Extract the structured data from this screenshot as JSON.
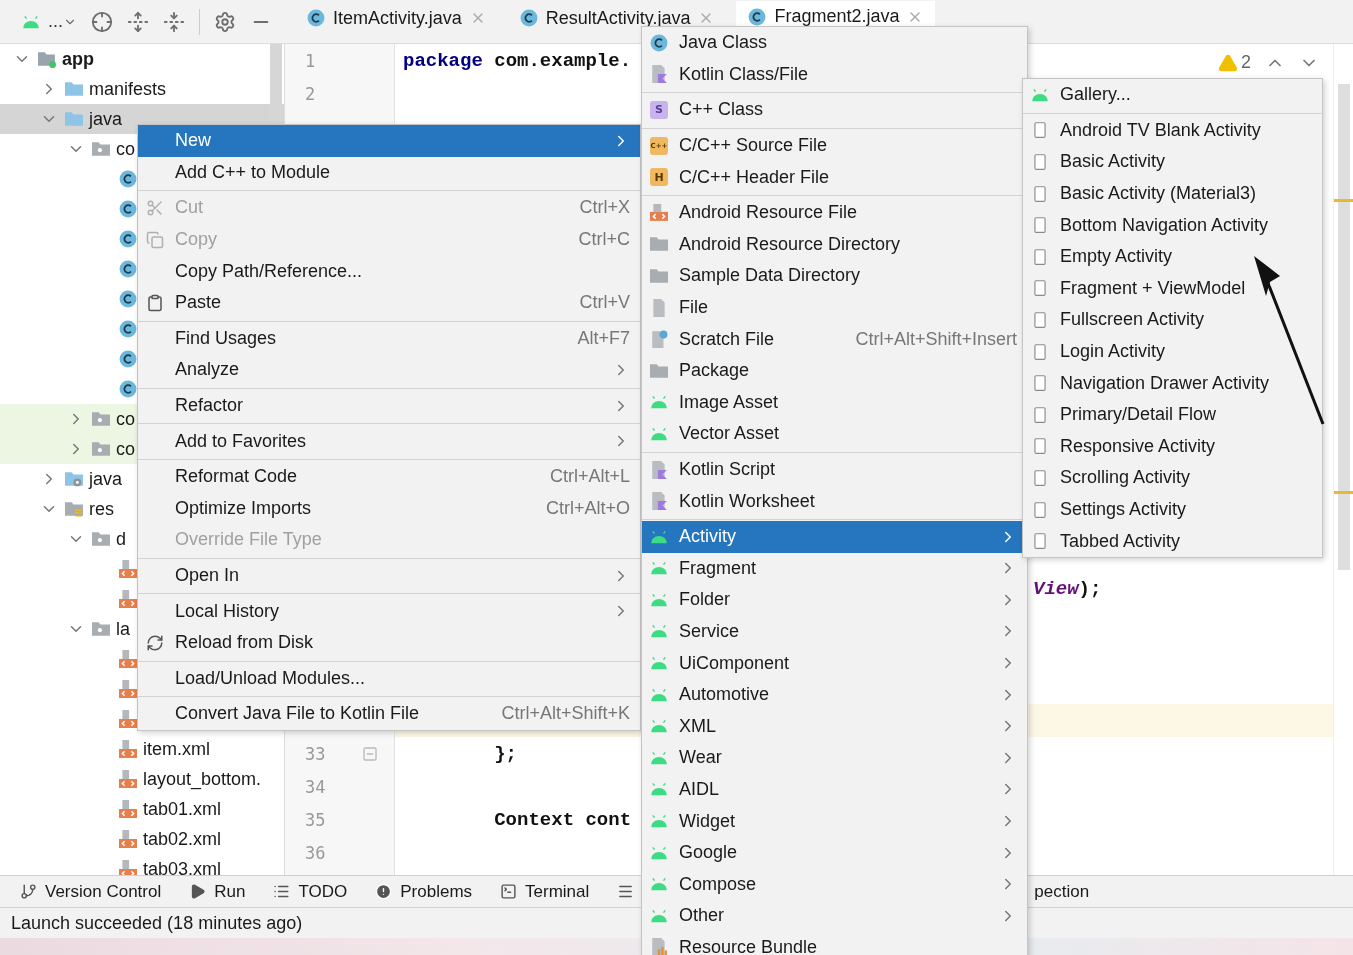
{
  "toolbar": {
    "view_selector": "..."
  },
  "tree": [
    {
      "label": "app",
      "kind": "module",
      "expanded": true,
      "selected": false,
      "highlighted": false,
      "children": [
        {
          "label": "manifests",
          "kind": "folder",
          "expanded": false,
          "selected": false,
          "highlighted": false
        },
        {
          "label": "java",
          "kind": "folder",
          "expanded": true,
          "selected": true,
          "highlighted": false,
          "children": [
            {
              "label": "co",
              "kind": "package",
              "expanded": true,
              "selected": false,
              "highlighted": false,
              "children": [
                {
                  "kind": "java-class",
                  "selected": false,
                  "highlighted": false
                },
                {
                  "kind": "java-class",
                  "selected": false,
                  "highlighted": false
                },
                {
                  "kind": "java-class",
                  "selected": false,
                  "highlighted": false
                },
                {
                  "kind": "java-class",
                  "selected": false,
                  "highlighted": false
                },
                {
                  "kind": "java-class",
                  "selected": false,
                  "highlighted": false
                },
                {
                  "kind": "java-class",
                  "selected": false,
                  "highlighted": false
                },
                {
                  "kind": "java-class",
                  "selected": false,
                  "highlighted": false
                },
                {
                  "kind": "java-class",
                  "selected": false,
                  "highlighted": false
                }
              ]
            },
            {
              "label": "co",
              "kind": "package",
              "expanded": false,
              "selected": false,
              "highlighted": true
            },
            {
              "label": "co",
              "kind": "package",
              "expanded": false,
              "selected": false,
              "highlighted": true
            }
          ]
        },
        {
          "label": "java",
          "kind": "generated",
          "expanded": false,
          "selected": false,
          "highlighted": false
        },
        {
          "label": "res",
          "kind": "res",
          "expanded": true,
          "selected": false,
          "highlighted": false,
          "children": [
            {
              "label": "d",
              "kind": "package",
              "expanded": true,
              "selected": false,
              "highlighted": false,
              "children": [
                {
                  "kind": "xml",
                  "selected": false,
                  "highlighted": false
                },
                {
                  "kind": "xml",
                  "selected": false,
                  "highlighted": false
                }
              ]
            },
            {
              "label": "la",
              "kind": "package",
              "expanded": true,
              "selected": false,
              "highlighted": false,
              "children": [
                {
                  "kind": "xml",
                  "selected": false,
                  "highlighted": false
                },
                {
                  "kind": "xml",
                  "selected": false,
                  "highlighted": false
                },
                {
                  "kind": "xml",
                  "selected": false,
                  "highlighted": false
                },
                {
                  "label": "item.xml",
                  "kind": "xml",
                  "selected": false,
                  "highlighted": false
                },
                {
                  "label": "layout_bottom.",
                  "kind": "xml",
                  "selected": false,
                  "highlighted": false
                },
                {
                  "label": "tab01.xml",
                  "kind": "xml",
                  "selected": false,
                  "highlighted": false
                },
                {
                  "label": "tab02.xml",
                  "kind": "xml",
                  "selected": false,
                  "highlighted": false
                },
                {
                  "label": "tab03.xml",
                  "kind": "xml",
                  "selected": false,
                  "highlighted": false
                }
              ]
            }
          ]
        }
      ]
    }
  ],
  "tabs": [
    {
      "label": "ItemActivity.java",
      "selected": false
    },
    {
      "label": "ResultActivity.java",
      "selected": false
    },
    {
      "label": "Fragment2.java",
      "selected": true
    }
  ],
  "editor": {
    "warning_count": "2",
    "top_lines": [
      {
        "number": "1",
        "code": "**package** com.example."
      },
      {
        "number": "2"
      }
    ],
    "middle_lines": [
      {
        "code": "*View*);"
      }
    ],
    "bottom_lines": [
      {
        "number": "33",
        "code": "        };",
        "fold": true
      },
      {
        "number": "34",
        "fold": false
      },
      {
        "number": "35",
        "code": "        Context cont",
        "fold": false
      },
      {
        "number": "36",
        "fold": false
      }
    ]
  },
  "tool_windows": [
    {
      "label": "Version Control",
      "kind": "branch"
    },
    {
      "label": "Run",
      "kind": "play"
    },
    {
      "label": "TODO",
      "kind": "list"
    },
    {
      "label": "Problems",
      "kind": "alert"
    },
    {
      "label": "Terminal",
      "kind": "terminal"
    },
    {
      "kind": "menu"
    },
    {
      "label": "pection",
      "kind": "plain"
    }
  ],
  "status_bar": "Launch succeeded (18 minutes ago)",
  "context_menu": [
    {
      "kind": "plain",
      "label": "New",
      "submenu": true,
      "disabled": false,
      "selected": true
    },
    {
      "kind": "plain",
      "label": "Add C++ to Module",
      "submenu": false,
      "disabled": false,
      "selected": false
    },
    {
      "kind": "separator"
    },
    {
      "kind": "cut",
      "label": "Cut",
      "shortcut": "Ctrl+X",
      "submenu": false,
      "disabled": true,
      "selected": false
    },
    {
      "kind": "copy",
      "label": "Copy",
      "shortcut": "Ctrl+C",
      "submenu": false,
      "disabled": true,
      "selected": false
    },
    {
      "kind": "plain",
      "label": "Copy Path/Reference...",
      "submenu": false,
      "disabled": false,
      "selected": false
    },
    {
      "kind": "paste",
      "label": "Paste",
      "shortcut": "Ctrl+V",
      "submenu": false,
      "disabled": false,
      "selected": false
    },
    {
      "kind": "separator"
    },
    {
      "kind": "plain",
      "label": "Find Usages",
      "shortcut": "Alt+F7",
      "submenu": false,
      "disabled": false,
      "selected": false
    },
    {
      "kind": "plain",
      "label": "Analyze",
      "submenu": true,
      "disabled": false,
      "selected": false
    },
    {
      "kind": "separator"
    },
    {
      "kind": "plain",
      "label": "Refactor",
      "submenu": true,
      "disabled": false,
      "selected": false
    },
    {
      "kind": "separator"
    },
    {
      "kind": "plain",
      "label": "Add to Favorites",
      "submenu": true,
      "disabled": false,
      "selected": false
    },
    {
      "kind": "separator"
    },
    {
      "kind": "plain",
      "label": "Reformat Code",
      "shortcut": "Ctrl+Alt+L",
      "submenu": false,
      "disabled": false,
      "selected": false
    },
    {
      "kind": "plain",
      "label": "Optimize Imports",
      "shortcut": "Ctrl+Alt+O",
      "submenu": false,
      "disabled": false,
      "selected": false
    },
    {
      "kind": "plain",
      "label": "Override File Type",
      "submenu": false,
      "disabled": true,
      "selected": false
    },
    {
      "kind": "separator"
    },
    {
      "kind": "plain",
      "label": "Open In",
      "submenu": true,
      "disabled": false,
      "selected": false
    },
    {
      "kind": "separator"
    },
    {
      "kind": "plain",
      "label": "Local History",
      "submenu": true,
      "disabled": false,
      "selected": false
    },
    {
      "kind": "reload",
      "label": "Reload from Disk",
      "submenu": false,
      "disabled": false,
      "selected": false
    },
    {
      "kind": "separator"
    },
    {
      "kind": "plain",
      "label": "Load/Unload Modules...",
      "submenu": false,
      "disabled": false,
      "selected": false
    },
    {
      "kind": "separator"
    },
    {
      "kind": "plain",
      "label": "Convert Java File to Kotlin File",
      "shortcut": "Ctrl+Alt+Shift+K",
      "submenu": false,
      "disabled": false,
      "selected": false
    }
  ],
  "new_submenu": [
    {
      "kind": "java-class",
      "label": "Java Class",
      "submenu": false,
      "selected": false
    },
    {
      "kind": "kotlin",
      "label": "Kotlin Class/File",
      "submenu": false,
      "selected": false
    },
    {
      "kind": "separator"
    },
    {
      "kind": "badge",
      "badge": "S",
      "label": "C++ Class",
      "submenu": false,
      "selected": false
    },
    {
      "kind": "separator"
    },
    {
      "kind": "badge-doc",
      "badge": "C++",
      "label": "C/C++ Source File",
      "submenu": false,
      "selected": false
    },
    {
      "kind": "badge-doc",
      "badge": "H",
      "label": "C/C++ Header File",
      "submenu": false,
      "selected": false
    },
    {
      "kind": "separator"
    },
    {
      "kind": "res-file",
      "label": "Android Resource File",
      "submenu": false,
      "selected": false
    },
    {
      "kind": "plain-folder",
      "label": "Android Resource Directory",
      "submenu": false,
      "selected": false
    },
    {
      "kind": "plain-folder",
      "label": "Sample Data Directory",
      "submenu": false,
      "selected": false
    },
    {
      "kind": "file",
      "label": "File",
      "submenu": false,
      "selected": false
    },
    {
      "kind": "scratch",
      "label": "Scratch File",
      "shortcut": "Ctrl+Alt+Shift+Insert",
      "submenu": false,
      "selected": false
    },
    {
      "kind": "plain-folder",
      "label": "Package",
      "submenu": false,
      "selected": false
    },
    {
      "kind": "android",
      "label": "Image Asset",
      "submenu": false,
      "selected": false
    },
    {
      "kind": "android",
      "label": "Vector Asset",
      "submenu": false,
      "selected": false
    },
    {
      "kind": "separator"
    },
    {
      "kind": "kotlin",
      "label": "Kotlin Script",
      "submenu": false,
      "selected": false
    },
    {
      "kind": "kotlin",
      "label": "Kotlin Worksheet",
      "submenu": false,
      "selected": false
    },
    {
      "kind": "separator"
    },
    {
      "kind": "android",
      "label": "Activity",
      "submenu": true,
      "selected": true
    },
    {
      "kind": "android",
      "label": "Fragment",
      "submenu": true,
      "selected": false
    },
    {
      "kind": "android",
      "label": "Folder",
      "submenu": true,
      "selected": false
    },
    {
      "kind": "android",
      "label": "Service",
      "submenu": true,
      "selected": false
    },
    {
      "kind": "android",
      "label": "UiComponent",
      "submenu": true,
      "selected": false
    },
    {
      "kind": "android",
      "label": "Automotive",
      "submenu": true,
      "selected": false
    },
    {
      "kind": "android",
      "label": "XML",
      "submenu": true,
      "selected": false
    },
    {
      "kind": "android",
      "label": "Wear",
      "submenu": true,
      "selected": false
    },
    {
      "kind": "android",
      "label": "AIDL",
      "submenu": true,
      "selected": false
    },
    {
      "kind": "android",
      "label": "Widget",
      "submenu": true,
      "selected": false
    },
    {
      "kind": "android",
      "label": "Google",
      "submenu": true,
      "selected": false
    },
    {
      "kind": "android",
      "label": "Compose",
      "submenu": true,
      "selected": false
    },
    {
      "kind": "android",
      "label": "Other",
      "submenu": true,
      "selected": false
    },
    {
      "kind": "bundle",
      "label": "Resource Bundle",
      "submenu": false,
      "selected": false
    }
  ],
  "activity_submenu": [
    {
      "kind": "android",
      "label": "Gallery...",
      "selected": false
    },
    {
      "kind": "separator"
    },
    {
      "kind": "template",
      "label": "Android TV Blank Activity",
      "selected": false
    },
    {
      "kind": "template",
      "label": "Basic Activity",
      "selected": false
    },
    {
      "kind": "template",
      "label": "Basic Activity (Material3)",
      "selected": false
    },
    {
      "kind": "template",
      "label": "Bottom Navigation Activity",
      "selected": false
    },
    {
      "kind": "template",
      "label": "Empty Activity",
      "selected": false
    },
    {
      "kind": "template",
      "label": "Fragment + ViewModel",
      "selected": false
    },
    {
      "kind": "template",
      "label": "Fullscreen Activity",
      "selected": false
    },
    {
      "kind": "template",
      "label": "Login Activity",
      "selected": false
    },
    {
      "kind": "template",
      "label": "Navigation Drawer Activity",
      "selected": false
    },
    {
      "kind": "template",
      "label": "Primary/Detail Flow",
      "selected": false
    },
    {
      "kind": "template",
      "label": "Responsive Activity",
      "selected": false
    },
    {
      "kind": "template",
      "label": "Scrolling Activity",
      "selected": false
    },
    {
      "kind": "template",
      "label": "Settings Activity",
      "selected": false
    },
    {
      "kind": "template",
      "label": "Tabbed Activity",
      "selected": false
    }
  ]
}
